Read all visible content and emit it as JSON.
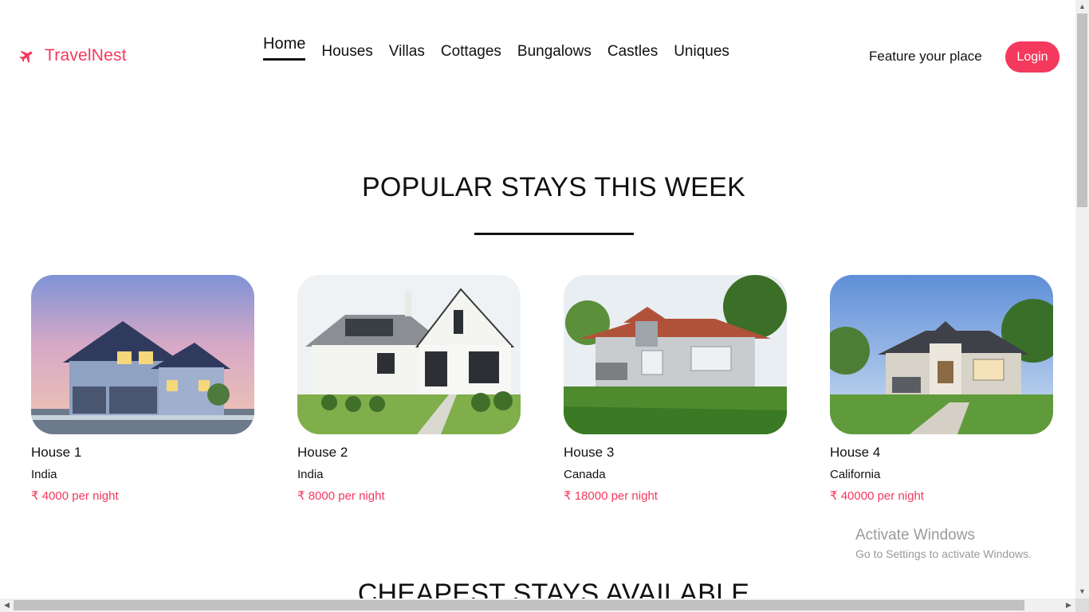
{
  "brand": {
    "name": "TravelNest",
    "icon": "plane-icon",
    "color": "#f5385d"
  },
  "nav": {
    "items": [
      {
        "label": "Home",
        "active": true
      },
      {
        "label": "Houses"
      },
      {
        "label": "Villas"
      },
      {
        "label": "Cottages"
      },
      {
        "label": "Bungalows"
      },
      {
        "label": "Castles"
      },
      {
        "label": "Uniques"
      }
    ]
  },
  "header": {
    "feature_label": "Feature your place",
    "login_label": "Login"
  },
  "popular": {
    "title": "POPULAR STAYS THIS WEEK",
    "cards": [
      {
        "name": "House 1",
        "location": "India",
        "price": "₹ 4000 per night"
      },
      {
        "name": "House 2",
        "location": "India",
        "price": "₹ 8000 per night"
      },
      {
        "name": "House 3",
        "location": "Canada",
        "price": "₹ 18000 per night"
      },
      {
        "name": "House 4",
        "location": "California",
        "price": "₹ 40000 per night"
      }
    ]
  },
  "cheapest": {
    "title": "CHEAPEST STAYS AVAILABLE"
  },
  "watermark": {
    "line1": "Activate Windows",
    "line2": "Go to Settings to activate Windows."
  }
}
